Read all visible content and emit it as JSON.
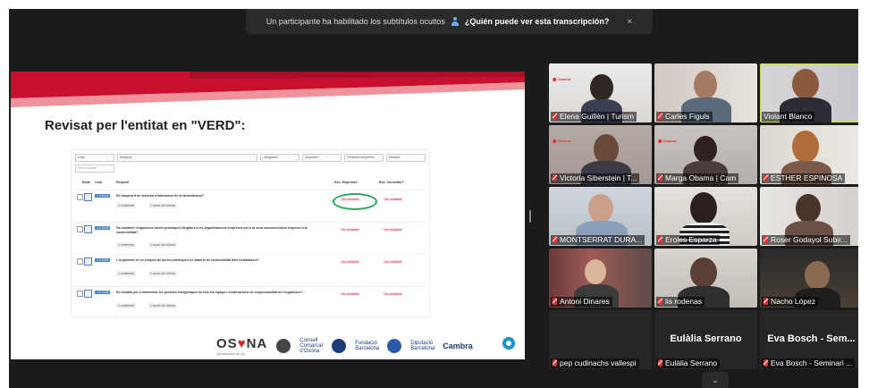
{
  "notification": {
    "message": "Un participante ha habilitado los subtítulos ocultos",
    "question": "¿Quién puede ver esta transcripción?",
    "close": "×"
  },
  "slide": {
    "title": "Revisat per l'entitat en \"VERD\":",
    "filters": [
      "Grup",
      "Subgrup",
      "Obligatori?",
      "Accepat?",
      "Revisant empresa?",
      "Revisat"
    ],
    "search_placeholder": "Text a buscar",
    "headers": [
      "Edita",
      "Codi",
      "Requisit",
      "Res. Empresa?",
      "Res. Consultor?"
    ],
    "rows": [
      {
        "code": "1.1.01.B",
        "text": "Es disposa d'un sistema d'indicadors de la dinamització?",
        "status1": "No revisada",
        "status2": "No revisada",
        "btn1": "1 evidència",
        "btn2": "1 acció de millora"
      },
      {
        "code": "1.1.02.B",
        "text": "Ha establert l'organisme bones pràctiques dirigides a les organitzacions empreses per a la seva conscienciació respecte a la sostenibilitat?",
        "status1": "No revisada",
        "status2": "No revisada",
        "btn1": "1 evidència",
        "btn2": "1 acció de millora"
      },
      {
        "code": "1.1.03.B",
        "text": "L'organisme té un conjunt de bones pràctiques en matèria de sostenibilitat dels treballadors?",
        "status1": "No revisada",
        "status2": "No revisada",
        "btn1": "1 evidència",
        "btn2": "1 acció de millora"
      },
      {
        "code": "1.1.04.B",
        "text": "Es treballa per a minimitzar les pèrdues energètiques de tots els equips i instal·lacions de responsabilitat de l'organisme?",
        "status1": "No revisada",
        "status2": "No revisada",
        "btn1": "1 evidència",
        "btn2": "1 acció de millora"
      }
    ],
    "footer": {
      "osona_a": "OS",
      "osona_b": "NA",
      "osona_sub": "Ajuntament de Vic",
      "logo2": "Consell Comarcal d'Osona",
      "logo3": "Fundació Barcelona",
      "logo4": "Diputació Barcelona",
      "cambra": "Cambra"
    }
  },
  "participants": [
    {
      "name": "Elena Guillén | Turism",
      "muted": true
    },
    {
      "name": "Carles Figuls",
      "muted": true
    },
    {
      "name": "Violant Blanco",
      "muted": false,
      "active": true
    },
    {
      "name": "Victoria Siberstein | T...",
      "muted": true
    },
    {
      "name": "Marga Obama | Cam",
      "muted": true
    },
    {
      "name": "ESTHER ESPINOSA",
      "muted": true
    },
    {
      "name": "MONTSERRAT DURA...",
      "muted": true
    },
    {
      "name": "Eroles Esparza",
      "muted": true
    },
    {
      "name": "Roser Godayol Subir...",
      "muted": true
    },
    {
      "name": "Antoni Dinares",
      "muted": true
    },
    {
      "name": "lis rodenas",
      "muted": true
    },
    {
      "name": "Nacho López",
      "muted": true
    },
    {
      "name": "pep cudinachs vallespi",
      "muted": true,
      "center": ""
    },
    {
      "name": "Eulàlia Serrano",
      "muted": true,
      "center": "Eulàlia Serrano"
    },
    {
      "name": "Eva Bosch - Seminari ...",
      "muted": true,
      "center": "Eva Bosch - Sem..."
    }
  ],
  "brand_colors": {
    "accent_red": "#d42b2b",
    "active_border": "#c9e35a",
    "highlight_circle": "#2fa85a"
  },
  "icons": {
    "more_down": "chevron-down-icon"
  }
}
